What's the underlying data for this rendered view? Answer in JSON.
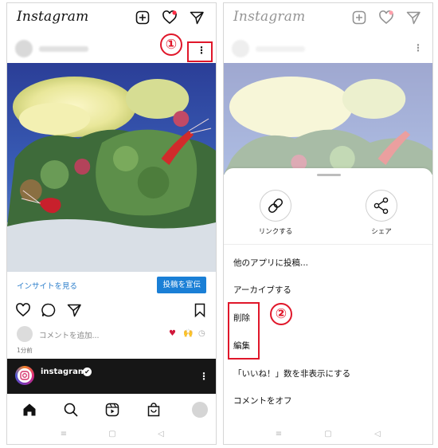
{
  "app": {
    "logo": "Instagram"
  },
  "left_screen": {
    "markers": {
      "step1": "①"
    },
    "insight_link": "インサイトを見る",
    "promote_button": "投稿を宣伝",
    "comment_placeholder": "コメントを追加...",
    "comment_emojis": [
      "♥",
      "🙌",
      "◷"
    ],
    "time_ago": "1分前",
    "story": {
      "account_name": "instagram",
      "verified_badge": "✔"
    }
  },
  "right_screen": {
    "markers": {
      "step2": "②"
    },
    "share_options": [
      {
        "label": "リンクする",
        "icon": "link-icon"
      },
      {
        "label": "シェア",
        "icon": "share-icon"
      }
    ],
    "menu": [
      "他のアプリに投稿...",
      "アーカイブする",
      "削除",
      "編集",
      "「いいね！」数を非表示にする",
      "コメントをオフ"
    ]
  },
  "system_nav": [
    "≡",
    "▢",
    "◁"
  ],
  "colors": {
    "accent": "#1a7fd6",
    "link": "#2f80cc",
    "highlight": "#e0172a",
    "story_bg": "#161616"
  }
}
